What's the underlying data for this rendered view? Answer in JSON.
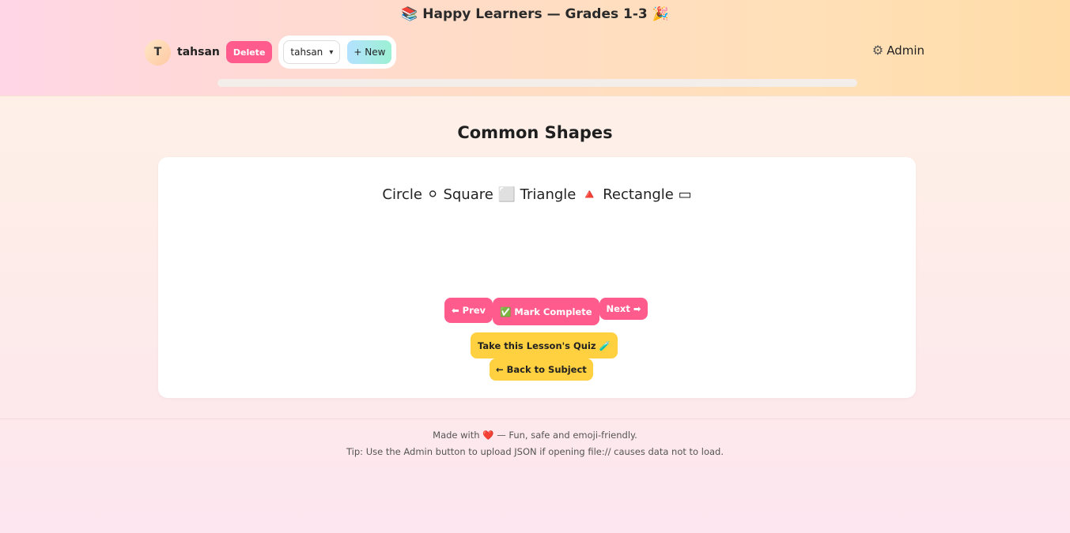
{
  "header": {
    "title": "📚 Happy Learners — Grades 1-3 🎉",
    "user": {
      "avatar_initial": "T",
      "name": "tahsan",
      "delete_label": "Delete",
      "selected_user": "tahsan",
      "new_label": "+ New"
    },
    "admin_label": "Admin",
    "admin_icon": "gear-icon",
    "progress_fraction": 0
  },
  "lesson": {
    "title": "Common Shapes",
    "content": "Circle ⚪ Square ⬜ Triangle 🔺 Rectangle ▭",
    "prev_label": "⬅ Prev",
    "complete_label": "✅ Mark Complete",
    "next_label": "Next ➡",
    "quiz_label": "Take this Lesson's Quiz 🧪",
    "back_label": "← Back to Subject"
  },
  "footer": {
    "made_with_prefix": "Made with",
    "heart": "❤️",
    "made_with_suffix": "— Fun, safe and emoji-friendly.",
    "tip": "Tip: Use the Admin button to upload JSON if opening file:// causes data not to load."
  },
  "colors": {
    "accent_pink": "#ff5c8d",
    "accent_yellow": "#ffd03f"
  }
}
